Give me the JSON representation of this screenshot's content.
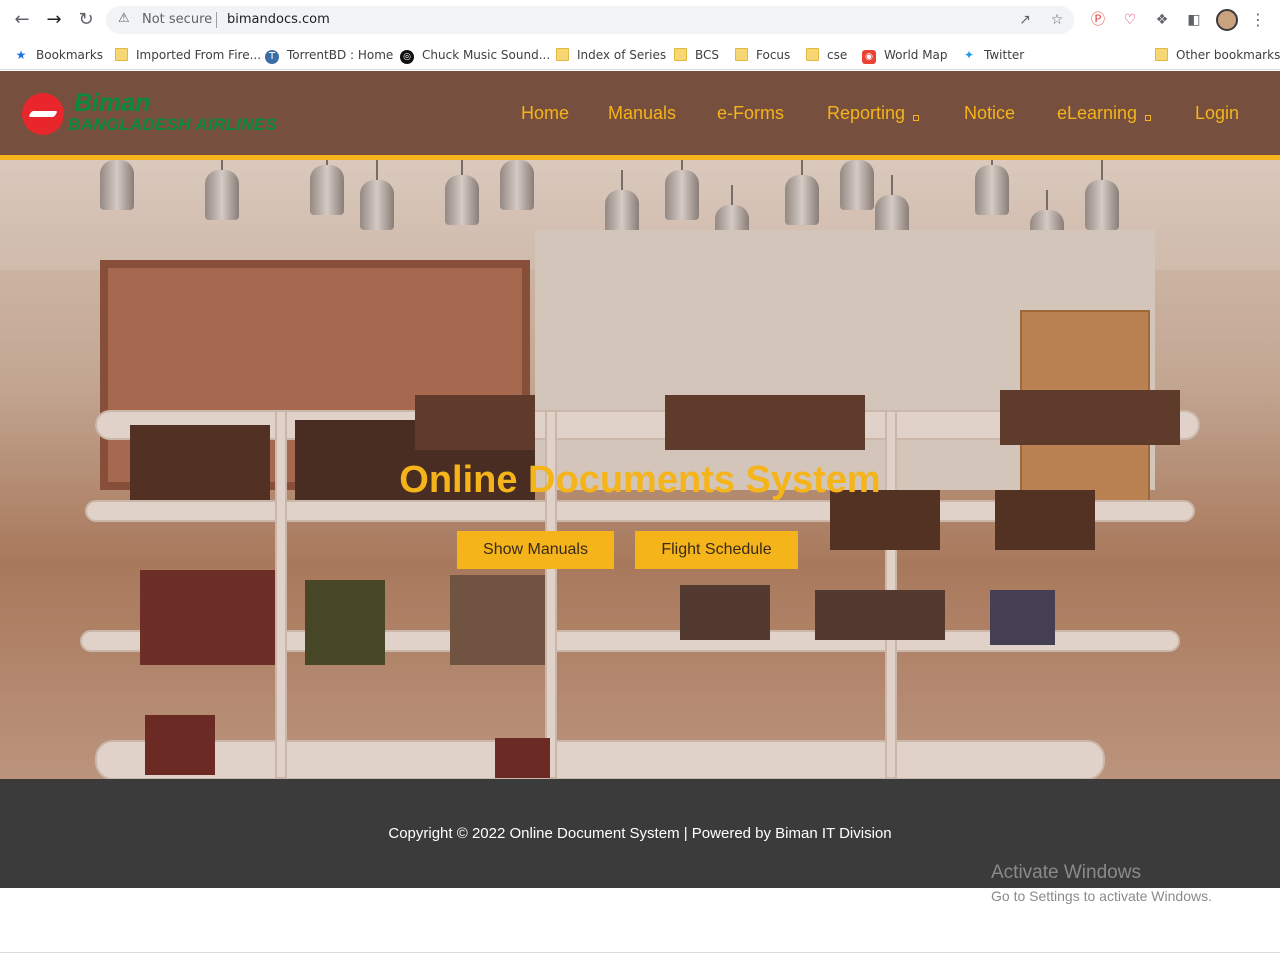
{
  "browser": {
    "security_label": "Not secure",
    "url": "bimandocs.com",
    "bookmarks": [
      {
        "label": "Bookmarks",
        "icon": "star-icon"
      },
      {
        "label": "Imported From Fire...",
        "icon": "folder-icon"
      },
      {
        "label": "TorrentBD : Home",
        "icon": "site-icon"
      },
      {
        "label": "Chuck Music Sound...",
        "icon": "site-icon"
      },
      {
        "label": "Index of Series",
        "icon": "folder-icon"
      },
      {
        "label": "BCS",
        "icon": "folder-icon"
      },
      {
        "label": "Focus",
        "icon": "folder-icon"
      },
      {
        "label": "cse",
        "icon": "folder-icon"
      },
      {
        "label": "World Map",
        "icon": "map-pin-icon"
      },
      {
        "label": "Twitter",
        "icon": "twitter-icon"
      }
    ],
    "other_bookmarks": "Other bookmarks"
  },
  "site": {
    "logo_line1": "Biman",
    "logo_line2": "BANGLADESH AIRLINES",
    "nav": [
      {
        "label": "Home"
      },
      {
        "label": "Manuals"
      },
      {
        "label": "e-Forms"
      },
      {
        "label": "Reporting"
      },
      {
        "label": "Notice"
      },
      {
        "label": "eLearning"
      },
      {
        "label": "Login"
      }
    ],
    "accent_color": "#f4b41a",
    "header_color": "#774f3f"
  },
  "hero": {
    "title": "Online Documents System",
    "buttons": [
      {
        "label": "Show Manuals"
      },
      {
        "label": "Flight Schedule"
      }
    ]
  },
  "footer": {
    "text": "Copyright © 2022 Online Document System | Powered by Biman IT Division"
  },
  "watermark": {
    "title": "Activate Windows",
    "subtitle": "Go to Settings to activate Windows."
  }
}
